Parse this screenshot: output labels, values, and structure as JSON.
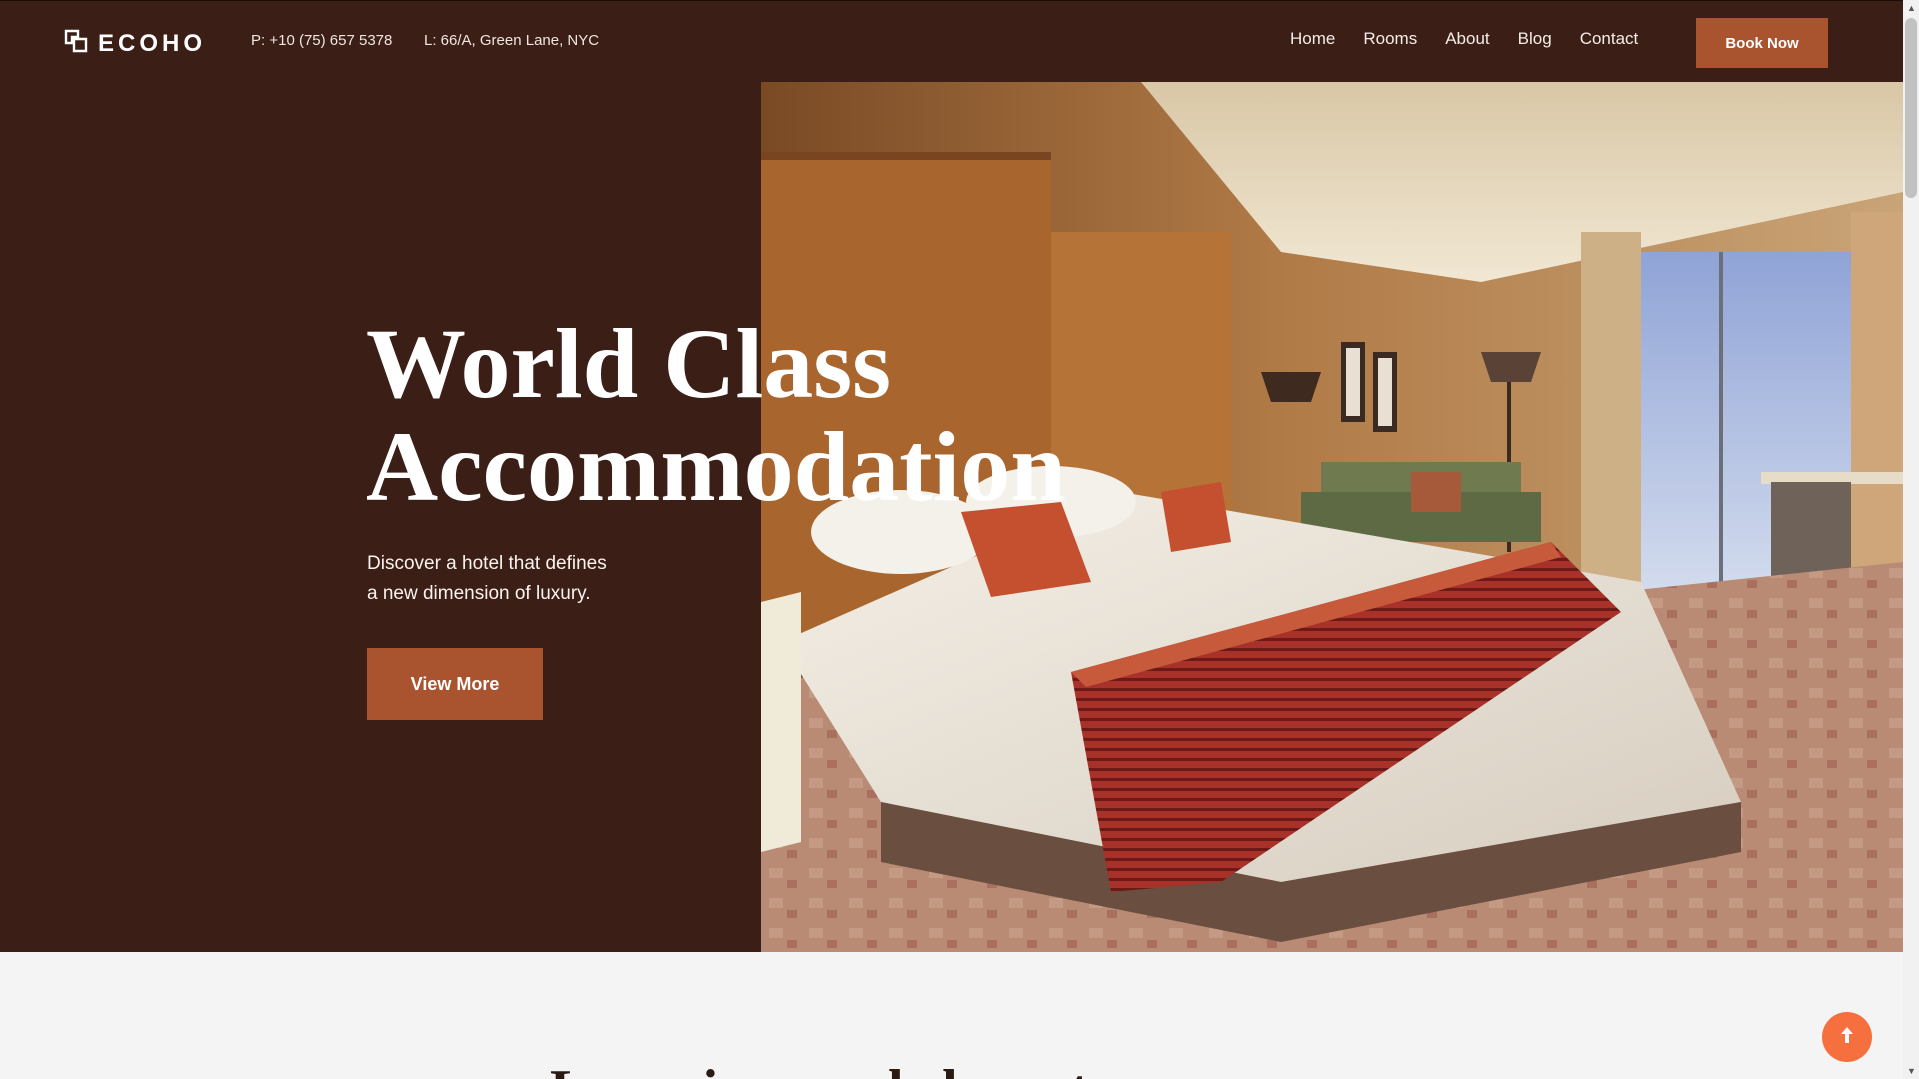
{
  "brand": {
    "name": "ECOHO",
    "logo_icon": "overlapping-squares-icon"
  },
  "header": {
    "phone": "P: +10 (75) 657 5378",
    "location": "L: 66/A, Green Lane, NYC",
    "nav": [
      "Home",
      "Rooms",
      "About",
      "Blog",
      "Contact"
    ],
    "book_label": "Book Now"
  },
  "hero": {
    "title_line1": "World Class",
    "title_line2": "Accommodation",
    "subtitle_line1": "Discover a hotel that defines",
    "subtitle_line2": "a new dimension of luxury.",
    "cta": "View More",
    "image": "hotel-bedroom-image"
  },
  "section": {
    "partial_heading": "Luxurious and elegant"
  },
  "scroll_top": {
    "icon": "arrow-up-icon"
  },
  "colors": {
    "primary_dark": "#3b1e15",
    "accent": "#a9532f",
    "scroll_top_bg": "#f6703f",
    "page_bg": "#f4f4f4"
  }
}
